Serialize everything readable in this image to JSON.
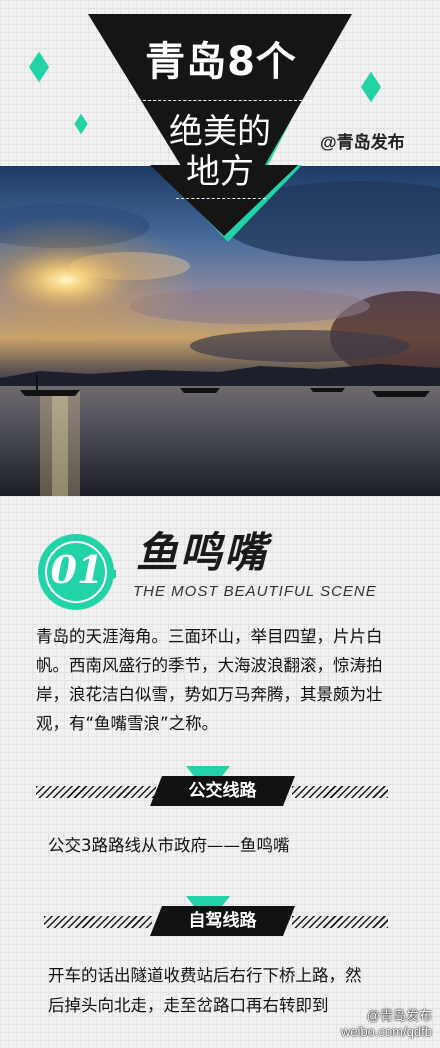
{
  "header": {
    "title_line1": "青岛8个",
    "title_line2": "绝美的",
    "title_line3": "地方",
    "weibo_handle": "@青岛发布",
    "colors": {
      "accent": "#22d3a8",
      "dark": "#151515"
    }
  },
  "section": {
    "number": "01",
    "title": "鱼鸣嘴",
    "subtitle": "THE MOST BEAUTIFUL SCENE",
    "description": "青岛的天涯海角。三面环山，举目四望，片片白帆。西南风盛行的季节，大海波浪翻滚，惊涛拍岸，浪花洁白似雪，势如万马奔腾，其景颇为壮观，有“鱼嘴雪浪”之称。"
  },
  "bus": {
    "label": "公交线路",
    "text": "公交3路路线从市政府——鱼鸣嘴"
  },
  "drive": {
    "label": "自驾线路",
    "text_line1": "开车的话出隧道收费站后右行下桥上路，然",
    "text_line2": "后掉头向北走，走至岔路口再右转即到"
  },
  "watermark": {
    "line1": "@青岛发布",
    "line2": "weibo.com/qdfb"
  }
}
